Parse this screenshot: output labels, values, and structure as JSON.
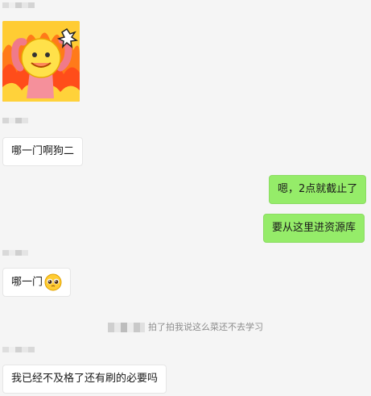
{
  "messages": {
    "m1_text": "哪一门啊狗二",
    "m2_text": "嗯，2点就截止了",
    "m3_text": "要从这里进资源库",
    "m4_text": "哪一门",
    "m5_text": "我已经不及格了还有刷的必要吗"
  },
  "system": {
    "pat_text": "拍了拍我说这么菜还不去学习"
  },
  "colors": {
    "background": "#f5f5f5",
    "bubble_left": "#ffffff",
    "bubble_right": "#95ec69",
    "system_text": "#8c8c8c"
  },
  "icons": {
    "sticker": "flame-smiley-sticker",
    "emoji": "pleading-face-emoji"
  }
}
